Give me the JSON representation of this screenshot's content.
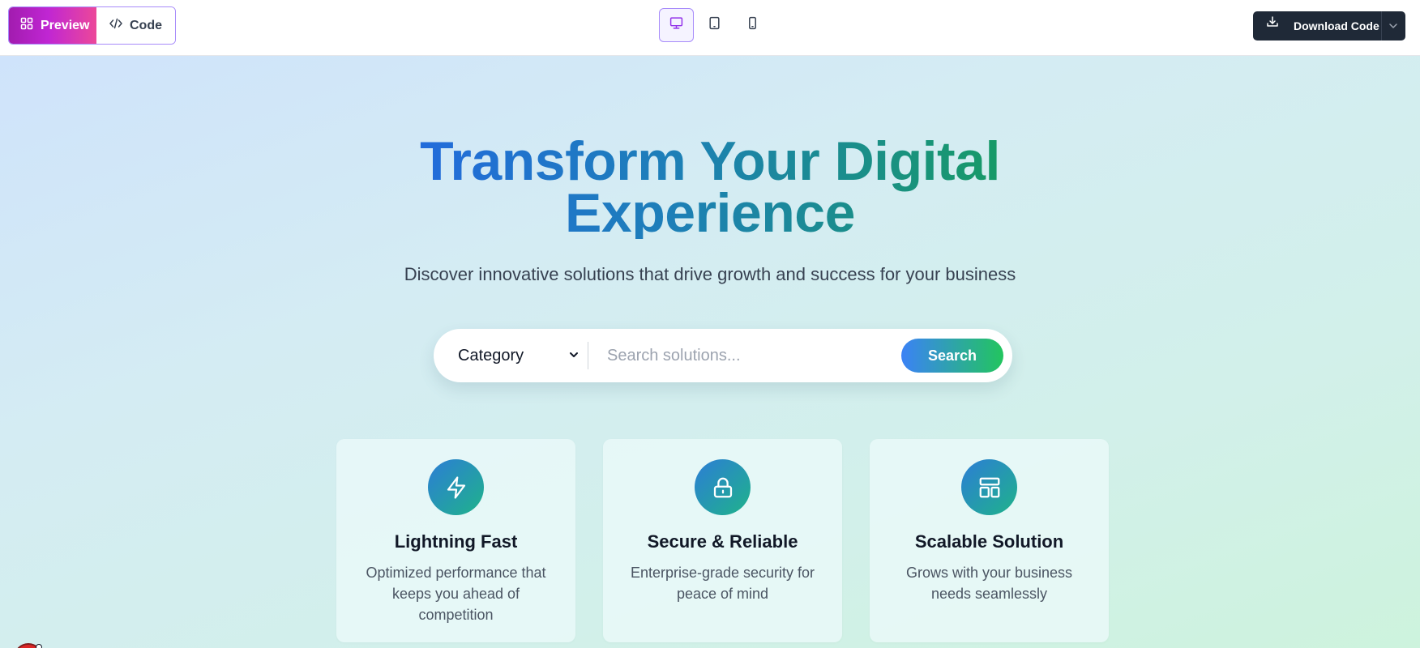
{
  "toolbar": {
    "preview_label": "Preview",
    "code_label": "Code",
    "download_label": "Download Code",
    "active_device": "desktop"
  },
  "hero": {
    "title": "Transform Your Digital Experience",
    "subtitle": "Discover innovative solutions that drive growth and success for your business",
    "category_label": "Category",
    "search_placeholder": "Search solutions...",
    "search_value": "",
    "search_button": "Search"
  },
  "features": [
    {
      "icon": "lightning-icon",
      "title": "Lightning Fast",
      "description": "Optimized performance that keeps you ahead of competition"
    },
    {
      "icon": "lock-icon",
      "title": "Secure & Reliable",
      "description": "Enterprise-grade security for peace of mind"
    },
    {
      "icon": "layout-icon",
      "title": "Scalable Solution",
      "description": "Grows with your business needs seamlessly"
    }
  ],
  "colors": {
    "accent_purple": "#a78bfa",
    "preview_gradient_start": "#a21caf",
    "preview_gradient_end": "#ec4899",
    "gradient_blue": "#3b82f6",
    "gradient_green": "#22c55e",
    "download_bg": "#1f2937"
  }
}
